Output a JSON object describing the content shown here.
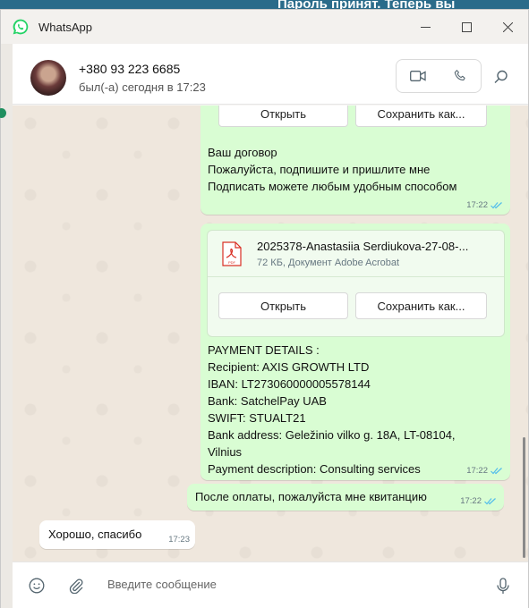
{
  "background": {
    "fragment_text": "Пароль принят. Теперь вы"
  },
  "window": {
    "title": "WhatsApp"
  },
  "contact": {
    "phone": "+380 93 223 6685",
    "status": "был(-а) сегодня в 17:23"
  },
  "messages": {
    "top_buttons": {
      "open": "Открыть",
      "save": "Сохранить как..."
    },
    "contract": {
      "lines": [
        "Ваш договор",
        "Пожалуйста, подпишите  и пришлите мне",
        "Подписать можете любым удобным способом"
      ],
      "time": "17:22"
    },
    "document": {
      "file_name": "2025378-Anastasiia Serdiukova-27-08-...",
      "file_info": "72 КБ, Документ Adobe Acrobat",
      "pdf_label": "PDF",
      "open": "Открыть",
      "save": "Сохранить как...",
      "lines": [
        "PAYMENT DETAILS :",
        "Recipient: AXIS GROWTH LTD",
        "IBAN: LT273060000005578144",
        "Bank: SatchelPay UAB",
        "SWIFT: STUALT21",
        "Bank address: Geležinio vilko g. 18A, LT-08104,",
        "Vilnius",
        "Payment description: Consulting services"
      ],
      "time": "17:22"
    },
    "receipt": {
      "text": "После оплаты, пожалуйста мне квитанцию",
      "time": "17:22"
    },
    "reply": {
      "text": "Хорошо, спасибо",
      "time": "17:23"
    }
  },
  "composer": {
    "placeholder": "Введите сообщение"
  },
  "colors": {
    "outgoing": "#d9fdd3",
    "incoming": "#ffffff",
    "chat_bg": "#efe7dd",
    "read_ticks": "#53bdeb",
    "brand": "#25d366"
  },
  "icons": [
    "whatsapp-logo-icon",
    "minimize-icon",
    "maximize-icon",
    "close-icon",
    "video-call-icon",
    "voice-call-icon",
    "search-icon",
    "pdf-file-icon",
    "read-receipt-icon",
    "emoji-icon",
    "attach-icon",
    "microphone-icon"
  ]
}
